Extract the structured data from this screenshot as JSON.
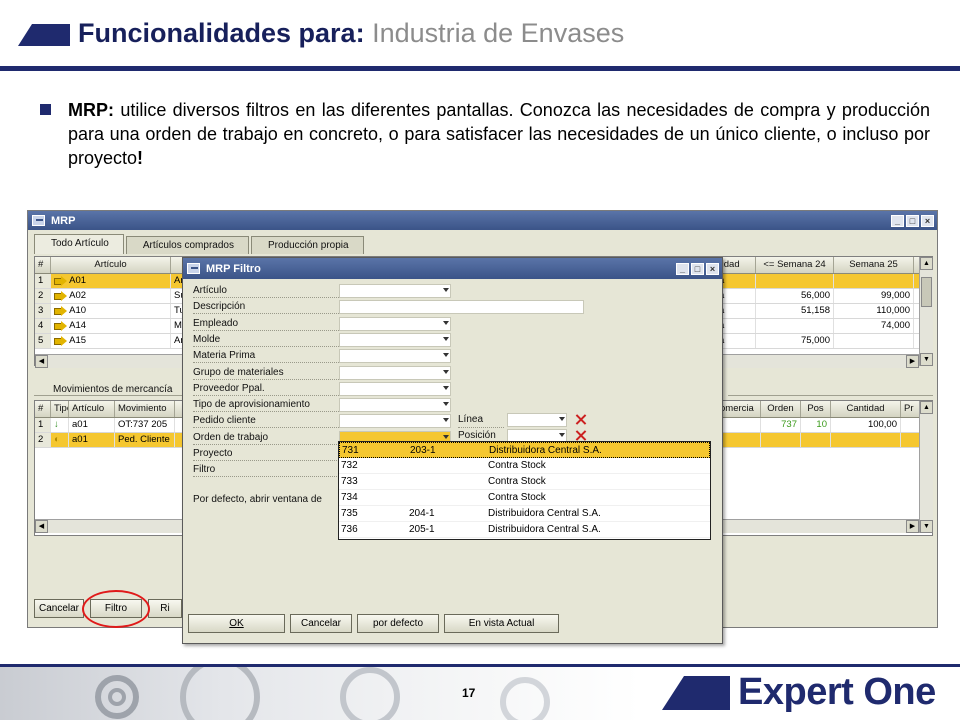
{
  "slide": {
    "title_bold": "Funcionalidades para:",
    "title_rest": "Industria de Envases",
    "bullet_label": "MRP:",
    "bullet_text": "utilice diversos filtros en las diferentes pantallas. Conozca las necesidades de compra y producción para una orden de trabajo en concreto, o para satisfacer las necesidades de un único cliente, o incluso por proyecto",
    "bullet_end": "!",
    "page_number": "17",
    "logo": "Expert One"
  },
  "mrp_window": {
    "title": "MRP",
    "tabs": [
      "Todo Artículo",
      "Artículos comprados",
      "Producción propia"
    ],
    "items_grid": {
      "columns": [
        "#",
        "Artículo",
        "",
        "tidad",
        "<= Semana 24",
        "Semana 25"
      ],
      "rows": [
        {
          "n": "1",
          "item": "A01",
          "desc": "Ar",
          "unit": "a",
          "w24": "",
          "w25": ""
        },
        {
          "n": "2",
          "item": "A02",
          "desc": "Su",
          "unit": "a",
          "w24": "56,000",
          "w25": "99,000"
        },
        {
          "n": "3",
          "item": "A10",
          "desc": "Tu",
          "unit": "a",
          "w24": "51,158",
          "w25": "110,000"
        },
        {
          "n": "4",
          "item": "A14",
          "desc": "M3",
          "unit": "a",
          "w24": "",
          "w25": "74,000"
        },
        {
          "n": "5",
          "item": "A15",
          "desc": "Ar",
          "unit": "a",
          "w24": "75,000",
          "w25": ""
        }
      ]
    },
    "movements_label": "Movimientos de mercancía",
    "movements_grid": {
      "columns": [
        "#",
        "Tipo",
        "Artículo",
        "Movimiento",
        "omercia",
        "Orden",
        "Pos",
        "Cantidad",
        "Pr"
      ],
      "rows": [
        {
          "n": "1",
          "item": "a01",
          "mov": "OT:737 205",
          "order": "737",
          "pos": "10",
          "qty": "100,00"
        },
        {
          "n": "2",
          "item": "a01",
          "mov": "Ped. Cliente",
          "order": "",
          "pos": "",
          "qty": ""
        }
      ]
    },
    "buttons": [
      "Cancelar",
      "Filtro",
      "Ri"
    ]
  },
  "filter_dialog": {
    "title": "MRP Filtro",
    "fields": [
      {
        "label": "Artículo",
        "dropdown": true
      },
      {
        "label": "Descripción",
        "dropdown": false
      },
      {
        "label": "Empleado",
        "dropdown": true
      },
      {
        "label": "Molde",
        "dropdown": true
      },
      {
        "label": "Materia Prima",
        "dropdown": true
      },
      {
        "label": "Grupo de materiales",
        "dropdown": true
      },
      {
        "label": "Proveedor Ppal.",
        "dropdown": true
      },
      {
        "label": "Tipo de aprovisionamiento",
        "dropdown": true
      },
      {
        "label": "Pedido cliente",
        "dropdown": true
      },
      {
        "label": "Orden de trabajo",
        "dropdown": true
      },
      {
        "label": "Proyecto",
        "dropdown": false
      },
      {
        "label": "Filtro",
        "dropdown": false
      }
    ],
    "side_fields": [
      "Línea",
      "Posición"
    ],
    "default_label": "Por defecto, abrir ventana de",
    "popup_rows": [
      {
        "code": "731",
        "ref": "203-1",
        "customer": "Distribuidora Central S.A."
      },
      {
        "code": "732",
        "ref": "",
        "customer": "Contra Stock"
      },
      {
        "code": "733",
        "ref": "",
        "customer": "Contra Stock"
      },
      {
        "code": "734",
        "ref": "",
        "customer": "Contra Stock"
      },
      {
        "code": "735",
        "ref": "204-1",
        "customer": "Distribuidora Central S.A."
      },
      {
        "code": "736",
        "ref": "205-1",
        "customer": "Distribuidora Central S.A."
      }
    ],
    "buttons": [
      "OK",
      "Cancelar",
      "por defecto",
      "En vista Actual"
    ]
  },
  "colors": {
    "navy": "#1f2a6e",
    "title_bar": "#3b5488",
    "selection": "#f5c730",
    "highlight_ring": "#e01a1a"
  }
}
